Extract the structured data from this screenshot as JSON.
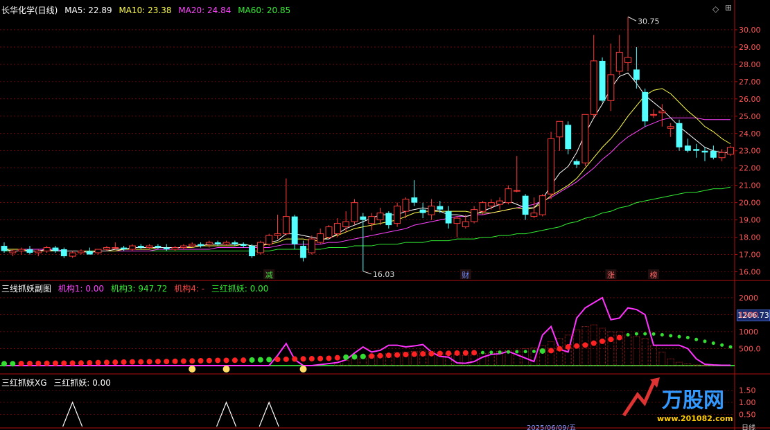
{
  "header": {
    "stock": "长华化学(日线)",
    "ma5": "MA5: 22.89",
    "ma10": "MA10: 23.38",
    "ma20": "MA20: 24.84",
    "ma60": "MA60: 20.85"
  },
  "colors": {
    "up": "#ff3b3b",
    "down": "#54ffff",
    "ma5": "#ffffff",
    "ma10": "#ffff4a",
    "ma20": "#ff44ff",
    "ma60": "#33ee33",
    "grid": "#b01010",
    "axis": "#b01010"
  },
  "main_chart": {
    "y_ticks": [
      "30.00",
      "29.00",
      "28.00",
      "27.00",
      "26.00",
      "25.00",
      "24.00",
      "23.00",
      "22.00",
      "21.00",
      "20.00",
      "19.00",
      "18.00",
      "17.00",
      "16.00"
    ],
    "high_label": "30.75",
    "low_label": "16.03",
    "event_labels": [
      {
        "text": "减",
        "color": "#44dd44"
      },
      {
        "text": "财",
        "color": "#6688ff"
      },
      {
        "text": "涨",
        "color": "#ff6666"
      },
      {
        "text": "榜",
        "color": "#ff6666"
      }
    ]
  },
  "sub1": {
    "title": "三线抓妖副图",
    "jg1": "机构1: 0.00",
    "jg3": "机构3: 947.72",
    "jg4": "机构4: -",
    "shzy": "三红抓妖: 0.00",
    "y_ticks": [
      "2000",
      "1500",
      "1000",
      "500.0"
    ],
    "current_value": "1206.73"
  },
  "sub2": {
    "title": "三红抓妖XG",
    "label": "三红抓妖: 0.00",
    "y_ticks": [
      "1.50",
      "1.00",
      "0.50"
    ]
  },
  "footer": {
    "date": "2025/06/09/五",
    "period": "日线"
  },
  "watermark": {
    "brand": "万股网",
    "url": "www.201082.com"
  },
  "chart_data": {
    "type": "candlestick",
    "ylim": [
      15.5,
      30.75
    ],
    "candles": [
      {
        "o": 17.5,
        "h": 17.7,
        "l": 17.1,
        "c": 17.2
      },
      {
        "o": 17.1,
        "h": 17.3,
        "l": 16.9,
        "c": 17.2
      },
      {
        "o": 17.2,
        "h": 17.4,
        "l": 17.0,
        "c": 17.3
      },
      {
        "o": 17.3,
        "h": 17.5,
        "l": 17.0,
        "c": 17.1
      },
      {
        "o": 17.1,
        "h": 17.3,
        "l": 16.9,
        "c": 17.2
      },
      {
        "o": 17.2,
        "h": 17.5,
        "l": 17.1,
        "c": 17.4
      },
      {
        "o": 17.4,
        "h": 17.5,
        "l": 17.1,
        "c": 17.2
      },
      {
        "o": 17.3,
        "h": 17.4,
        "l": 16.8,
        "c": 16.9
      },
      {
        "o": 16.9,
        "h": 17.2,
        "l": 16.8,
        "c": 17.1
      },
      {
        "o": 17.1,
        "h": 17.3,
        "l": 17.0,
        "c": 17.2
      },
      {
        "o": 17.2,
        "h": 17.4,
        "l": 17.0,
        "c": 17.0
      },
      {
        "o": 17.1,
        "h": 17.3,
        "l": 17.0,
        "c": 17.3
      },
      {
        "o": 17.3,
        "h": 17.5,
        "l": 17.2,
        "c": 17.4
      },
      {
        "o": 17.4,
        "h": 17.7,
        "l": 17.3,
        "c": 17.4
      },
      {
        "o": 17.4,
        "h": 17.5,
        "l": 17.2,
        "c": 17.3
      },
      {
        "o": 17.3,
        "h": 17.6,
        "l": 17.2,
        "c": 17.5
      },
      {
        "o": 17.5,
        "h": 17.6,
        "l": 17.3,
        "c": 17.4
      },
      {
        "o": 17.4,
        "h": 17.6,
        "l": 17.3,
        "c": 17.5
      },
      {
        "o": 17.5,
        "h": 17.6,
        "l": 17.3,
        "c": 17.4
      },
      {
        "o": 17.4,
        "h": 17.6,
        "l": 17.2,
        "c": 17.3
      },
      {
        "o": 17.3,
        "h": 17.5,
        "l": 17.2,
        "c": 17.4
      },
      {
        "o": 17.4,
        "h": 17.6,
        "l": 17.3,
        "c": 17.5
      },
      {
        "o": 17.5,
        "h": 17.7,
        "l": 17.4,
        "c": 17.6
      },
      {
        "o": 17.6,
        "h": 17.7,
        "l": 17.4,
        "c": 17.5
      },
      {
        "o": 17.6,
        "h": 17.8,
        "l": 17.4,
        "c": 17.7
      },
      {
        "o": 17.7,
        "h": 17.8,
        "l": 17.5,
        "c": 17.6
      },
      {
        "o": 17.6,
        "h": 17.8,
        "l": 17.5,
        "c": 17.7
      },
      {
        "o": 17.7,
        "h": 17.8,
        "l": 17.5,
        "c": 17.6
      },
      {
        "o": 17.6,
        "h": 17.7,
        "l": 17.4,
        "c": 17.5
      },
      {
        "o": 17.5,
        "h": 17.6,
        "l": 16.8,
        "c": 16.9
      },
      {
        "o": 17.1,
        "h": 17.8,
        "l": 17.0,
        "c": 17.7
      },
      {
        "o": 17.6,
        "h": 18.2,
        "l": 17.5,
        "c": 18.1
      },
      {
        "o": 18.1,
        "h": 19.3,
        "l": 17.9,
        "c": 18.2
      },
      {
        "o": 18.2,
        "h": 21.4,
        "l": 18.1,
        "c": 19.2
      },
      {
        "o": 19.2,
        "h": 19.3,
        "l": 17.3,
        "c": 17.6
      },
      {
        "o": 17.5,
        "h": 17.8,
        "l": 16.6,
        "c": 16.8
      },
      {
        "o": 17.1,
        "h": 18.1,
        "l": 17.0,
        "c": 17.9
      },
      {
        "o": 17.7,
        "h": 18.5,
        "l": 17.6,
        "c": 18.2
      },
      {
        "o": 18.0,
        "h": 18.7,
        "l": 17.9,
        "c": 18.6
      },
      {
        "o": 18.2,
        "h": 19.1,
        "l": 18.0,
        "c": 18.8
      },
      {
        "o": 18.6,
        "h": 19.5,
        "l": 18.3,
        "c": 18.9
      },
      {
        "o": 18.9,
        "h": 20.2,
        "l": 18.7,
        "c": 20.0
      },
      {
        "o": 19.2,
        "h": 19.4,
        "l": 16.03,
        "c": 19.0
      },
      {
        "o": 18.8,
        "h": 19.4,
        "l": 18.4,
        "c": 19.2
      },
      {
        "o": 19.0,
        "h": 19.7,
        "l": 18.7,
        "c": 19.4
      },
      {
        "o": 19.4,
        "h": 19.5,
        "l": 18.5,
        "c": 18.7
      },
      {
        "o": 18.8,
        "h": 20.0,
        "l": 18.6,
        "c": 19.8
      },
      {
        "o": 19.5,
        "h": 20.3,
        "l": 19.1,
        "c": 20.2
      },
      {
        "o": 20.3,
        "h": 21.3,
        "l": 19.8,
        "c": 20.0
      },
      {
        "o": 19.6,
        "h": 20.0,
        "l": 19.1,
        "c": 19.4
      },
      {
        "o": 19.3,
        "h": 20.2,
        "l": 19.0,
        "c": 19.8
      },
      {
        "o": 19.8,
        "h": 20.1,
        "l": 19.4,
        "c": 19.6
      },
      {
        "o": 19.5,
        "h": 19.8,
        "l": 18.5,
        "c": 18.8
      },
      {
        "o": 18.8,
        "h": 19.2,
        "l": 18.0,
        "c": 19.1
      },
      {
        "o": 18.6,
        "h": 19.3,
        "l": 18.5,
        "c": 18.9
      },
      {
        "o": 18.9,
        "h": 19.8,
        "l": 18.8,
        "c": 19.6
      },
      {
        "o": 19.5,
        "h": 20.1,
        "l": 19.3,
        "c": 20.0
      },
      {
        "o": 19.8,
        "h": 20.2,
        "l": 19.6,
        "c": 20.0
      },
      {
        "o": 19.9,
        "h": 20.3,
        "l": 19.6,
        "c": 20.1
      },
      {
        "o": 20.0,
        "h": 21.0,
        "l": 19.9,
        "c": 20.8
      },
      {
        "o": 20.7,
        "h": 22.7,
        "l": 20.6,
        "c": 20.7
      },
      {
        "o": 20.4,
        "h": 20.5,
        "l": 19.0,
        "c": 19.3
      },
      {
        "o": 19.2,
        "h": 20.3,
        "l": 19.1,
        "c": 19.4
      },
      {
        "o": 19.3,
        "h": 20.5,
        "l": 19.2,
        "c": 20.4
      },
      {
        "o": 20.5,
        "h": 24.1,
        "l": 20.2,
        "c": 23.7
      },
      {
        "o": 23.8,
        "h": 24.6,
        "l": 23.0,
        "c": 24.7
      },
      {
        "o": 24.5,
        "h": 24.7,
        "l": 22.8,
        "c": 23.1
      },
      {
        "o": 22.4,
        "h": 22.5,
        "l": 22.0,
        "c": 22.2
      },
      {
        "o": 22.3,
        "h": 24.4,
        "l": 22.1,
        "c": 25.1
      },
      {
        "o": 25.1,
        "h": 29.7,
        "l": 24.9,
        "c": 28.2
      },
      {
        "o": 28.2,
        "h": 28.4,
        "l": 25.8,
        "c": 25.9
      },
      {
        "o": 25.9,
        "h": 29.2,
        "l": 25.3,
        "c": 27.4
      },
      {
        "o": 27.6,
        "h": 29.7,
        "l": 27.4,
        "c": 28.7
      },
      {
        "o": 28.1,
        "h": 30.75,
        "l": 27.6,
        "c": 28.4
      },
      {
        "o": 27.7,
        "h": 29.0,
        "l": 26.6,
        "c": 27.1
      },
      {
        "o": 26.4,
        "h": 26.6,
        "l": 24.4,
        "c": 24.7
      },
      {
        "o": 25.1,
        "h": 25.4,
        "l": 24.9,
        "c": 25.1
      },
      {
        "o": 25.2,
        "h": 25.7,
        "l": 24.4,
        "c": 25.3
      },
      {
        "o": 24.3,
        "h": 24.6,
        "l": 23.8,
        "c": 24.4
      },
      {
        "o": 24.6,
        "h": 24.8,
        "l": 23.0,
        "c": 23.2
      },
      {
        "o": 23.3,
        "h": 23.7,
        "l": 22.9,
        "c": 23.0
      },
      {
        "o": 23.1,
        "h": 23.4,
        "l": 22.6,
        "c": 23.0
      },
      {
        "o": 23.0,
        "h": 23.2,
        "l": 22.4,
        "c": 22.9
      },
      {
        "o": 23.0,
        "h": 23.3,
        "l": 22.5,
        "c": 22.6
      },
      {
        "o": 22.6,
        "h": 23.1,
        "l": 22.4,
        "c": 22.9
      },
      {
        "o": 22.8,
        "h": 23.3,
        "l": 22.7,
        "c": 23.2
      }
    ],
    "ma5": [
      17.3,
      17.2,
      17.2,
      17.2,
      17.2,
      17.3,
      17.2,
      17.2,
      17.2,
      17.2,
      17.1,
      17.2,
      17.2,
      17.3,
      17.3,
      17.4,
      17.4,
      17.4,
      17.4,
      17.4,
      17.4,
      17.4,
      17.5,
      17.5,
      17.6,
      17.6,
      17.6,
      17.6,
      17.6,
      17.5,
      17.5,
      17.7,
      17.8,
      18.2,
      18.2,
      18.1,
      18.0,
      17.9,
      17.9,
      18.2,
      18.5,
      18.7,
      18.9,
      19.1,
      19.3,
      19.3,
      19.3,
      19.5,
      19.6,
      19.7,
      19.6,
      19.5,
      19.3,
      19.3,
      19.2,
      19.3,
      19.5,
      19.7,
      19.9,
      20.1,
      19.9,
      19.7,
      19.7,
      20.2,
      21.0,
      21.7,
      22.1,
      22.9,
      24.0,
      24.9,
      25.7,
      26.6,
      27.3,
      27.5,
      26.9,
      26.2,
      25.8,
      25.4,
      24.9,
      24.4,
      24.0,
      23.6,
      23.2,
      23.0,
      22.9,
      22.9
    ],
    "ma10": [
      17.3,
      17.3,
      17.3,
      17.2,
      17.2,
      17.2,
      17.2,
      17.2,
      17.2,
      17.2,
      17.2,
      17.2,
      17.2,
      17.2,
      17.3,
      17.3,
      17.3,
      17.3,
      17.4,
      17.4,
      17.4,
      17.4,
      17.4,
      17.5,
      17.5,
      17.5,
      17.5,
      17.5,
      17.6,
      17.5,
      17.5,
      17.6,
      17.7,
      17.9,
      17.9,
      17.9,
      17.8,
      17.8,
      18.0,
      18.1,
      18.3,
      18.5,
      18.6,
      18.7,
      18.8,
      18.9,
      19.0,
      19.2,
      19.4,
      19.5,
      19.5,
      19.5,
      19.5,
      19.5,
      19.5,
      19.4,
      19.4,
      19.4,
      19.5,
      19.6,
      19.7,
      19.6,
      19.7,
      20.0,
      20.4,
      20.7,
      21.0,
      21.4,
      22.0,
      22.6,
      23.2,
      23.7,
      24.3,
      25.0,
      25.6,
      26.2,
      26.5,
      26.6,
      26.3,
      25.8,
      25.3,
      24.9,
      24.4,
      24.1,
      23.7,
      23.4
    ],
    "ma20": [
      17.3,
      17.3,
      17.3,
      17.3,
      17.3,
      17.3,
      17.3,
      17.2,
      17.2,
      17.2,
      17.2,
      17.2,
      17.2,
      17.2,
      17.2,
      17.2,
      17.2,
      17.2,
      17.3,
      17.3,
      17.3,
      17.3,
      17.3,
      17.3,
      17.3,
      17.4,
      17.4,
      17.4,
      17.4,
      17.4,
      17.4,
      17.4,
      17.5,
      17.6,
      17.6,
      17.6,
      17.6,
      17.6,
      17.7,
      17.7,
      17.8,
      17.9,
      18.0,
      18.1,
      18.2,
      18.3,
      18.4,
      18.5,
      18.7,
      18.8,
      18.9,
      19.0,
      19.1,
      19.2,
      19.2,
      19.3,
      19.3,
      19.4,
      19.5,
      19.6,
      19.7,
      19.8,
      19.9,
      20.1,
      20.3,
      20.6,
      20.9,
      21.2,
      21.6,
      22.0,
      22.5,
      22.9,
      23.4,
      23.8,
      24.1,
      24.4,
      24.6,
      24.8,
      24.9,
      24.9,
      24.9,
      24.9,
      24.8,
      24.8,
      24.8,
      24.8
    ],
    "ma60": [
      17.2,
      17.2,
      17.2,
      17.2,
      17.2,
      17.2,
      17.2,
      17.2,
      17.2,
      17.2,
      17.2,
      17.2,
      17.2,
      17.2,
      17.2,
      17.2,
      17.2,
      17.2,
      17.2,
      17.2,
      17.2,
      17.2,
      17.2,
      17.2,
      17.2,
      17.2,
      17.2,
      17.2,
      17.2,
      17.2,
      17.2,
      17.2,
      17.3,
      17.3,
      17.3,
      17.3,
      17.3,
      17.3,
      17.4,
      17.4,
      17.4,
      17.5,
      17.5,
      17.5,
      17.6,
      17.6,
      17.6,
      17.7,
      17.7,
      17.7,
      17.8,
      17.8,
      17.8,
      17.9,
      17.9,
      17.9,
      18.0,
      18.0,
      18.1,
      18.1,
      18.2,
      18.2,
      18.3,
      18.4,
      18.5,
      18.6,
      18.8,
      18.9,
      19.1,
      19.2,
      19.4,
      19.5,
      19.7,
      19.8,
      20.0,
      20.1,
      20.2,
      20.3,
      20.4,
      20.5,
      20.6,
      20.6,
      20.7,
      20.8,
      20.8,
      20.9
    ],
    "sub1": {
      "ylim": [
        0,
        2100
      ],
      "magenta": [
        0,
        0,
        0,
        0,
        0,
        0,
        0,
        0,
        0,
        0,
        0,
        0,
        0,
        0,
        0,
        0,
        0,
        0,
        0,
        0,
        0,
        0,
        0,
        0,
        0,
        0,
        0,
        0,
        0,
        0,
        0,
        0,
        300,
        650,
        180,
        0,
        0,
        30,
        60,
        90,
        170,
        370,
        550,
        400,
        450,
        600,
        600,
        550,
        580,
        620,
        400,
        270,
        250,
        80,
        70,
        120,
        250,
        330,
        350,
        420,
        320,
        220,
        120,
        900,
        1150,
        480,
        400,
        1400,
        1700,
        1850,
        2000,
        1350,
        1400,
        1700,
        1650,
        1500,
        600,
        600,
        600,
        600,
        500,
        200,
        40,
        20,
        10,
        10
      ],
      "redbars": [
        0,
        0,
        0,
        0,
        0,
        0,
        0,
        0,
        0,
        0,
        0,
        0,
        0,
        0,
        0,
        0,
        0,
        0,
        0,
        0,
        0,
        0,
        0,
        0,
        0,
        0,
        0,
        0,
        0,
        0,
        0,
        0,
        0,
        0,
        0,
        0,
        0,
        0,
        0,
        100,
        150,
        200,
        250,
        300,
        300,
        350,
        380,
        400,
        420,
        450,
        420,
        380,
        350,
        320,
        300,
        330,
        360,
        390,
        420,
        440,
        450,
        500,
        520,
        600,
        700,
        800,
        900,
        1050,
        1150,
        1200,
        1100,
        1000,
        1000,
        900,
        850,
        800,
        600,
        400,
        200,
        100,
        50,
        20,
        10,
        10,
        0,
        0
      ],
      "dots": [
        0,
        0,
        0,
        0,
        0,
        0,
        0,
        0,
        0,
        0,
        0,
        0,
        0,
        0,
        0,
        0,
        0,
        0,
        0,
        0,
        0,
        0,
        0,
        0,
        0,
        0,
        0,
        0,
        0,
        0,
        0,
        0,
        0,
        0,
        0,
        0,
        0,
        0,
        0,
        0,
        0,
        0,
        0,
        0,
        0,
        0,
        0,
        0,
        0,
        0,
        0,
        0,
        0,
        0,
        0,
        0,
        0,
        0,
        0,
        0,
        0,
        0,
        0,
        0,
        0,
        0,
        0,
        0,
        0,
        0,
        0,
        0,
        0,
        0,
        0,
        0,
        0,
        0,
        0,
        0,
        0,
        0,
        0,
        0,
        0,
        0
      ],
      "dots_series": [
        {
          "y": [
            100,
            100,
            110,
            115,
            120,
            125,
            130,
            130,
            135,
            140,
            150,
            160,
            170,
            180,
            190,
            200,
            200,
            210,
            220,
            220,
            230,
            240,
            250,
            260,
            270,
            280,
            280,
            285,
            290,
            300,
            310,
            320,
            330,
            340,
            350,
            360,
            370,
            380,
            390,
            420,
            450,
            470,
            490,
            510,
            530,
            550,
            570,
            590,
            610,
            630,
            640,
            650,
            660,
            670,
            680,
            690,
            700,
            710,
            720,
            730,
            740,
            750,
            760,
            780,
            800,
            900,
            1000,
            1050,
            1100,
            1200,
            1300,
            1400,
            1500,
            1650,
            1700,
            1700,
            1690,
            1650,
            1600,
            1550,
            1500,
            1400,
            1300,
            1200,
            1100,
            1000
          ]
        }
      ]
    },
    "sub2": {
      "ylim": [
        0,
        1.6
      ],
      "spikes": [
        6,
        22,
        26
      ]
    }
  }
}
